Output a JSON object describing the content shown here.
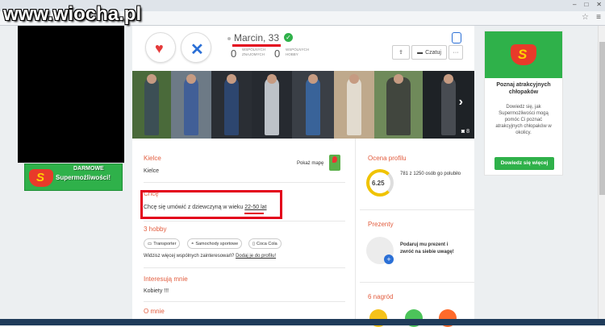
{
  "watermark": "www.wiocha.pl",
  "browser": {
    "url": "/",
    "window_controls": [
      "–",
      "□",
      "✕"
    ],
    "star": "☆",
    "menu": "≡"
  },
  "left_banner": {
    "line1": "DARMOWE",
    "line2": "Supermożliwości!"
  },
  "profile": {
    "name": "Marcin, 33",
    "stats": [
      {
        "value": "0",
        "label": "WSPÓLNYCH ZNAJOMYCH"
      },
      {
        "value": "0",
        "label": "WSPÓLNYCH HOBBY"
      }
    ],
    "chat_label": "Czatuj",
    "more_label": "···",
    "share_label": "⇪"
  },
  "photos": {
    "count_label": "8"
  },
  "location": {
    "title": "Kielce",
    "value": "Kielce",
    "map_link": "Pokaż mapę"
  },
  "wants": {
    "title": "Chcę",
    "text_prefix": "Chcę się umówić z dziewczyną w wieku ",
    "age_range": "22-50 lat"
  },
  "hobby": {
    "title": "3 hobby",
    "items": [
      "Transporter",
      "Samochody sportowe",
      "Coca Cola"
    ],
    "prompt": "Widzisz więcej wspólnych zainteresowań?",
    "add_link": "Dodaj je do profilu!"
  },
  "interests": {
    "title": "Interesują mnie",
    "value": "Kobiety !!!"
  },
  "about": {
    "title": "O mnie"
  },
  "rating": {
    "title": "Ocena profilu",
    "score": "6.25",
    "text": "781 z 1250 osób go polubiło"
  },
  "gifts": {
    "title": "Prezenty",
    "text_line1": "Podaruj mu prezent i",
    "text_line2": "zwróć na siebie uwagę!"
  },
  "awards": {
    "title": "6 nagród"
  },
  "right_ad": {
    "title": "Poznaj atrakcyjnych chłopaków",
    "desc": "Dowiedz się, jak Supermożliwości mogą pomóc Ci poznać atrakcyjnych chłopaków w okolicy.",
    "button": "Dowiedz się więcej"
  }
}
